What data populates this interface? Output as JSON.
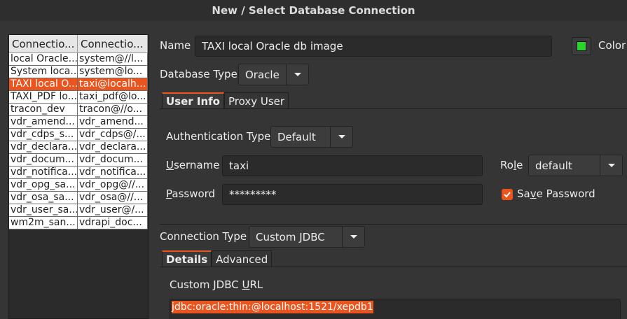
{
  "window": {
    "title": "New / Select Database Connection"
  },
  "connections": {
    "headers": [
      "Connectio...",
      "Connectio..."
    ],
    "rows": [
      [
        "local Oracle...",
        "system@//l..."
      ],
      [
        "System loca...",
        "system@lo..."
      ],
      [
        "TAXI local O...",
        "taxi@localh..."
      ],
      [
        "TAXI_PDF lo...",
        "taxi_pdf@lo..."
      ],
      [
        "tracon_dev",
        "tracon@//o..."
      ],
      [
        "vdr_amend...",
        "vdr_amend..."
      ],
      [
        "vdr_cdps_s...",
        "vdr_cdps@/..."
      ],
      [
        "vdr_declara...",
        "vdr_declara..."
      ],
      [
        "vdr_docum...",
        "vdr_docum..."
      ],
      [
        "vdr_notifica...",
        "vdr_notifica..."
      ],
      [
        "vdr_opg_sa...",
        "vdr_opg@//..."
      ],
      [
        "vdr_osa_sa...",
        "vdr_osa@//..."
      ],
      [
        "vdr_user_sa...",
        "vdr_user@/..."
      ],
      [
        "wm2m_san...",
        "vdrapi_doc..."
      ]
    ],
    "selected_index": 2
  },
  "form": {
    "name_label": "Name",
    "name_value": "TAXI local Oracle db image",
    "color_label": "Color",
    "color_value": "#2ad42a",
    "db_type_label": "Database Type",
    "db_type_value": "Oracle",
    "tabs_top": [
      "User Info",
      "Proxy User"
    ],
    "auth_type_label": "Authentication Type",
    "auth_type_value": "Default",
    "username_label_u": "U",
    "username_label_rest": "sername",
    "username_value": "taxi",
    "role_label_a": "Ro",
    "role_label_u": "l",
    "role_label_b": "e",
    "role_value": "default",
    "password_label_u": "P",
    "password_label_rest": "assword",
    "password_value": "*********",
    "save_password_a": "Sa",
    "save_password_u": "v",
    "save_password_b": "e Password",
    "conn_type_label": "Connection Type",
    "conn_type_value": "Custom JDBC",
    "tabs_bottom": [
      "Details",
      "Advanced"
    ],
    "jdbc_label_a": "Custom JDBC ",
    "jdbc_label_u": "U",
    "jdbc_label_b": "RL",
    "jdbc_value": "jdbc:oracle:thin:@localhost:1521/xepdb1"
  },
  "colors": {
    "accent": "#e9541f",
    "background": "#353535"
  }
}
